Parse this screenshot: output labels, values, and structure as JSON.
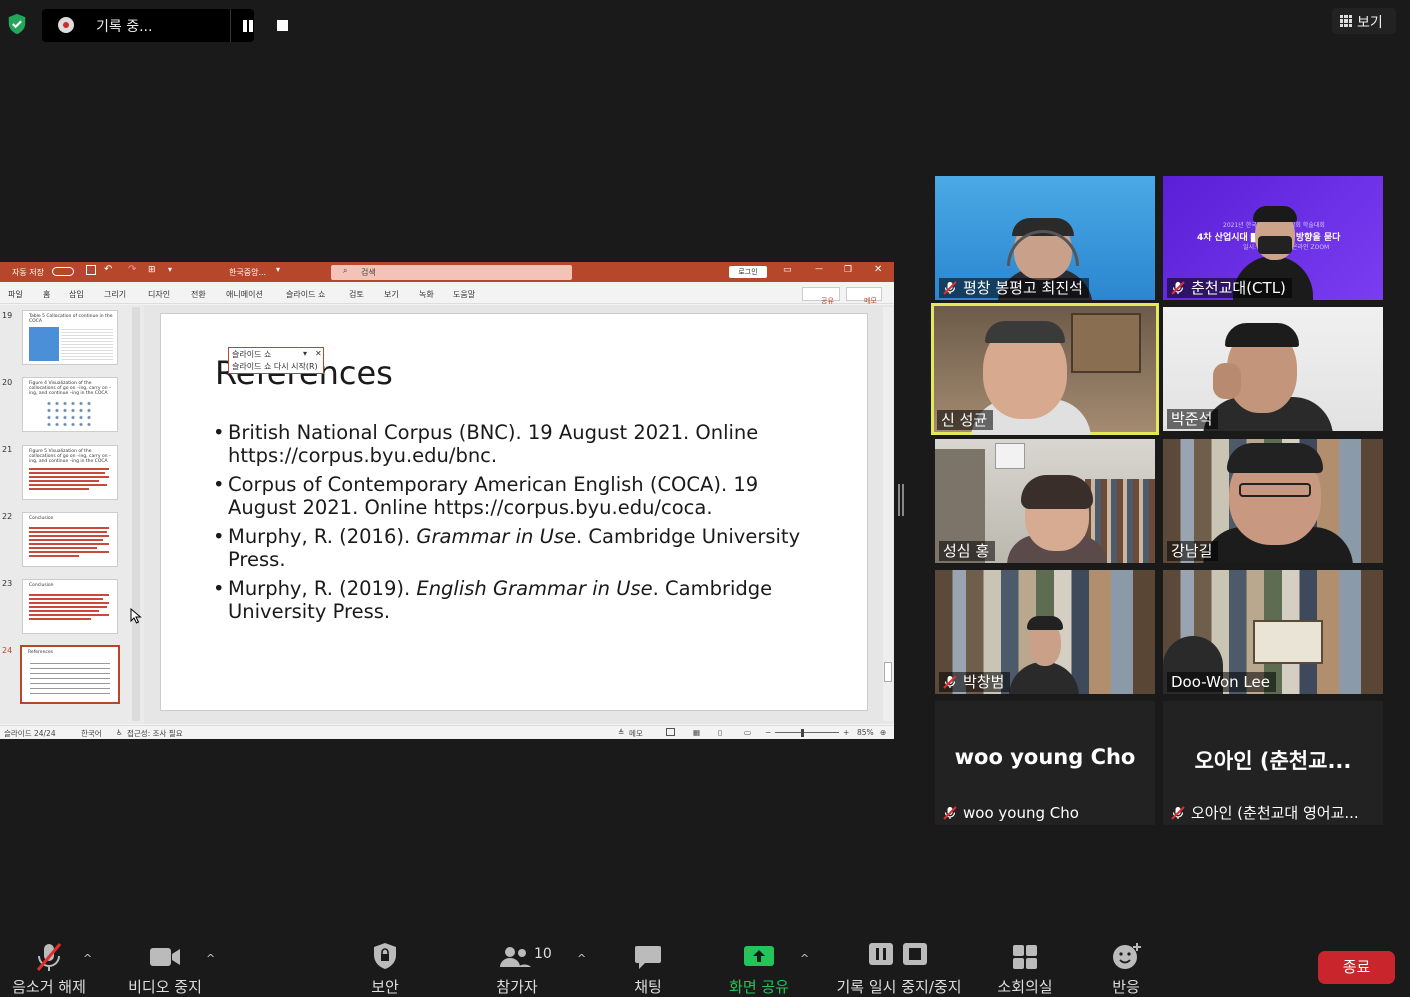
{
  "recording": {
    "label": "기록 중..."
  },
  "view_button": {
    "label": "보기"
  },
  "ppt": {
    "autosave": "자동 저장",
    "doc_name": "한국중앙...",
    "search_placeholder": "검색",
    "login": "로그인",
    "tabs": [
      "파일",
      "홈",
      "삽입",
      "그리기",
      "디자인",
      "전환",
      "애니메이션",
      "슬라이드 쇼",
      "검토",
      "보기",
      "녹화",
      "도움말"
    ],
    "share": "공유",
    "memo": "메모",
    "thumbnails": [
      {
        "num": "19",
        "title": "Table 5 Collocation of continue in the COCA"
      },
      {
        "num": "20",
        "title": "Figure 4 Visualization of the collocations of go on –ing, carry on –ing, and continue –ing in the COCA"
      },
      {
        "num": "21",
        "title": "Figure 5 Visualization of the collocations of go on –ing, carry on –ing, and continue –ing in the COCA"
      },
      {
        "num": "22",
        "title": "Conclusion"
      },
      {
        "num": "23",
        "title": "Conclusion"
      },
      {
        "num": "24",
        "title": "References"
      }
    ],
    "slide": {
      "heading": "References",
      "refs": [
        {
          "pre": "British National Corpus (BNC). 19 August 2021. Online https://corpus.byu.edu/bnc.",
          "em": "",
          "post": ""
        },
        {
          "pre": "Corpus of Contemporary American English (COCA). 19 August 2021. Online https://corpus.byu.edu/coca.",
          "em": "",
          "post": ""
        },
        {
          "pre": "Murphy, R. (2016). ",
          "em": "Grammar in Use",
          "post": ". Cambridge University Press."
        },
        {
          "pre": "Murphy, R. (2019). ",
          "em": "English Grammar in Use",
          "post": ". Cambridge University Press."
        }
      ]
    },
    "slideshow_popup": {
      "title": "슬라이드 쇼",
      "item": "슬라이드 쇼 다시 시작(R)"
    },
    "status": {
      "slide": "슬라이드 24/24",
      "lang": "한국어",
      "access": "접근성: 조사 필요",
      "notes": "메모",
      "zoom": "85%"
    }
  },
  "participants": [
    {
      "name": "평창 봉평고 최진석",
      "muted": true
    },
    {
      "name": "춘천교대(CTL)",
      "muted": true
    },
    {
      "name": "신 성균",
      "muted": false,
      "speaking": true
    },
    {
      "name": "박준석",
      "muted": false
    },
    {
      "name": "성심 홍",
      "muted": false
    },
    {
      "name": "강남길",
      "muted": false
    },
    {
      "name": "박창범",
      "muted": true
    },
    {
      "name": "Doo-Won Lee",
      "muted": false
    },
    {
      "name": "woo young Cho",
      "muted": true,
      "big": "woo young Cho"
    },
    {
      "name": "오아인 (춘천교대 영어교...",
      "muted": true,
      "big": "오아인 (춘천교..."
    }
  ],
  "tile2_text": {
    "line1": "2021년 한국중앙영어영문학회 학술대회",
    "line2": "4차 산업시대 ▇▇ 연구의 방향을 묻다",
    "line3": "일시: 2021.  장소: 온라인 ZOOM"
  },
  "toolbar": {
    "unmute": "음소거 해제",
    "video": "비디오 중지",
    "security": "보안",
    "participants": "참가자",
    "participant_count": "10",
    "chat": "채팅",
    "share": "화면 공유",
    "record": "기록 일시 중지/중지",
    "breakout": "소회의실",
    "reactions": "반응",
    "end": "종료"
  }
}
